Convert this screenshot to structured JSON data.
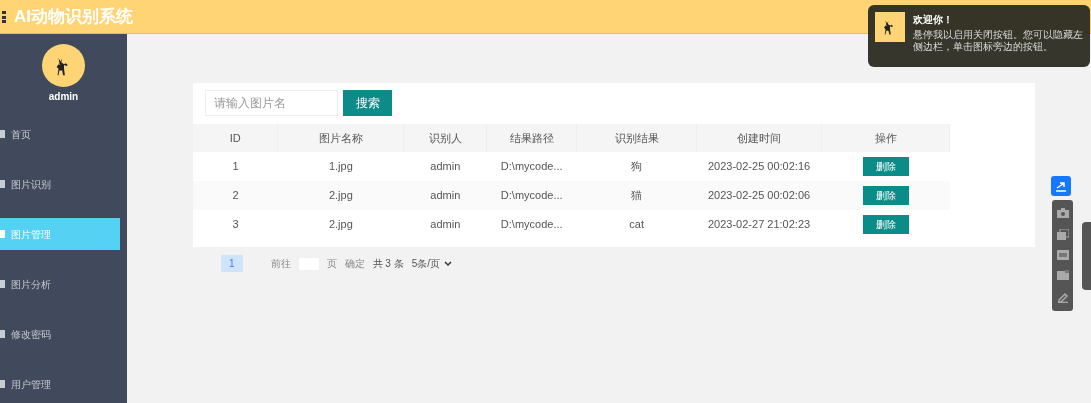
{
  "header": {
    "title": "AI动物识别系统"
  },
  "sidebar": {
    "user": "admin",
    "items": [
      {
        "label": "首页",
        "selected": false
      },
      {
        "label": "图片识别",
        "selected": false
      },
      {
        "label": "图片管理",
        "selected": true
      },
      {
        "label": "图片分析",
        "selected": false
      },
      {
        "label": "修改密码",
        "selected": false
      },
      {
        "label": "用户管理",
        "selected": false
      }
    ]
  },
  "search": {
    "placeholder": "请输入图片名",
    "button": "搜索"
  },
  "table": {
    "columns": [
      "ID",
      "图片名称",
      "识别人",
      "结果路径",
      "识别结果",
      "创建时间",
      "操作"
    ],
    "rows": [
      {
        "cells": [
          "1",
          "1.jpg",
          "admin",
          "D:\\mycode...",
          "狗",
          "2023-02-25 00:02:16"
        ],
        "action": "删除"
      },
      {
        "cells": [
          "2",
          "2.jpg",
          "admin",
          "D:\\mycode...",
          "猫",
          "2023-02-25 00:02:06"
        ],
        "action": "删除"
      },
      {
        "cells": [
          "3",
          "2.jpg",
          "admin",
          "D:\\mycode...",
          "cat",
          "2023-02-27 21:02:23"
        ],
        "action": "删除"
      }
    ]
  },
  "pagination": {
    "page": "1",
    "goto": "前往",
    "page_unit": "页",
    "confirm": "确定",
    "total": "共 3 条",
    "page_size": "5条/页"
  },
  "toast": {
    "title": "欢迎你！",
    "message": "悬停我以启用关闭按钮。您可以隐藏左侧边栏，单击图标旁边的按钮。"
  }
}
